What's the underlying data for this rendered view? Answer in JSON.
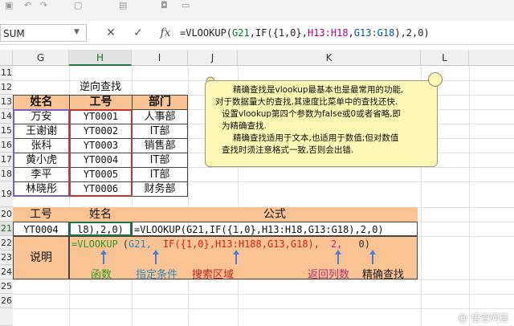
{
  "formula_bar": {
    "name_box": "SUM",
    "cancel_glyph": "✕",
    "confirm_glyph": "✓",
    "fx_glyph": "fx",
    "formula_parts": [
      "=VLOOKUP(",
      "G21",
      ",IF({1,0},",
      "H13:H18",
      ",",
      "G13:G18",
      "),2,0)"
    ]
  },
  "columns": [
    "G",
    "H",
    "I",
    "J",
    "K",
    "L"
  ],
  "rows": [
    "11",
    "12",
    "13",
    "14",
    "15",
    "16",
    "17",
    "18",
    "19",
    "20",
    "21",
    "22",
    "23",
    "24",
    "25",
    "26"
  ],
  "table": {
    "title": "逆向查找",
    "headers": [
      "姓名",
      "工号",
      "部门"
    ],
    "rows": [
      [
        "万安",
        "YT0001",
        "人事部"
      ],
      [
        "王谢谢",
        "YT0002",
        "IT部"
      ],
      [
        "张科",
        "YT0003",
        "销售部"
      ],
      [
        "黄小虎",
        "YT0004",
        "IT部"
      ],
      [
        "李平",
        "YT0005",
        "IT部"
      ],
      [
        "林晓彤",
        "YT0006",
        "财务部"
      ]
    ]
  },
  "comment": {
    "lines": [
      "精确查找是vlookup最基本也是最常用的功能,",
      "对于数据量大的查找,其速度比菜单中的查找还快.",
      "设置vlookup第四个参数为false或0或者省略,即",
      "为精确查找.",
      "精确查找适用于文本,也适用于数值;但对数值",
      "查找时须注意格式一致,否则会出错."
    ]
  },
  "lookup": {
    "headers": [
      "工号",
      "姓名",
      "公式"
    ],
    "input": "YT0004",
    "edit_text": "l8),2,0)",
    "formula_text": "=VLOOKUP(G21,IF({1,0},H13:H18,G13:G18),2,0)",
    "label": "说明",
    "breakdown": {
      "p1": "=VLOOKUP",
      "p2": "(",
      "p3": "G21,",
      "p4": "IF({1,0},H13:H188,G13,G18),",
      "p5": "2,",
      "p6": "0)"
    },
    "legend": [
      "函数",
      "指定条件",
      "搜索区域",
      "返回列数",
      "精确查找"
    ]
  },
  "colors": {
    "accent_green": "#217346",
    "header_orange": "#f9c393",
    "comment_bg": "#fbf7b4",
    "arrow_blue": "#4f7bd8"
  },
  "watermark": "@ 悟空问答"
}
